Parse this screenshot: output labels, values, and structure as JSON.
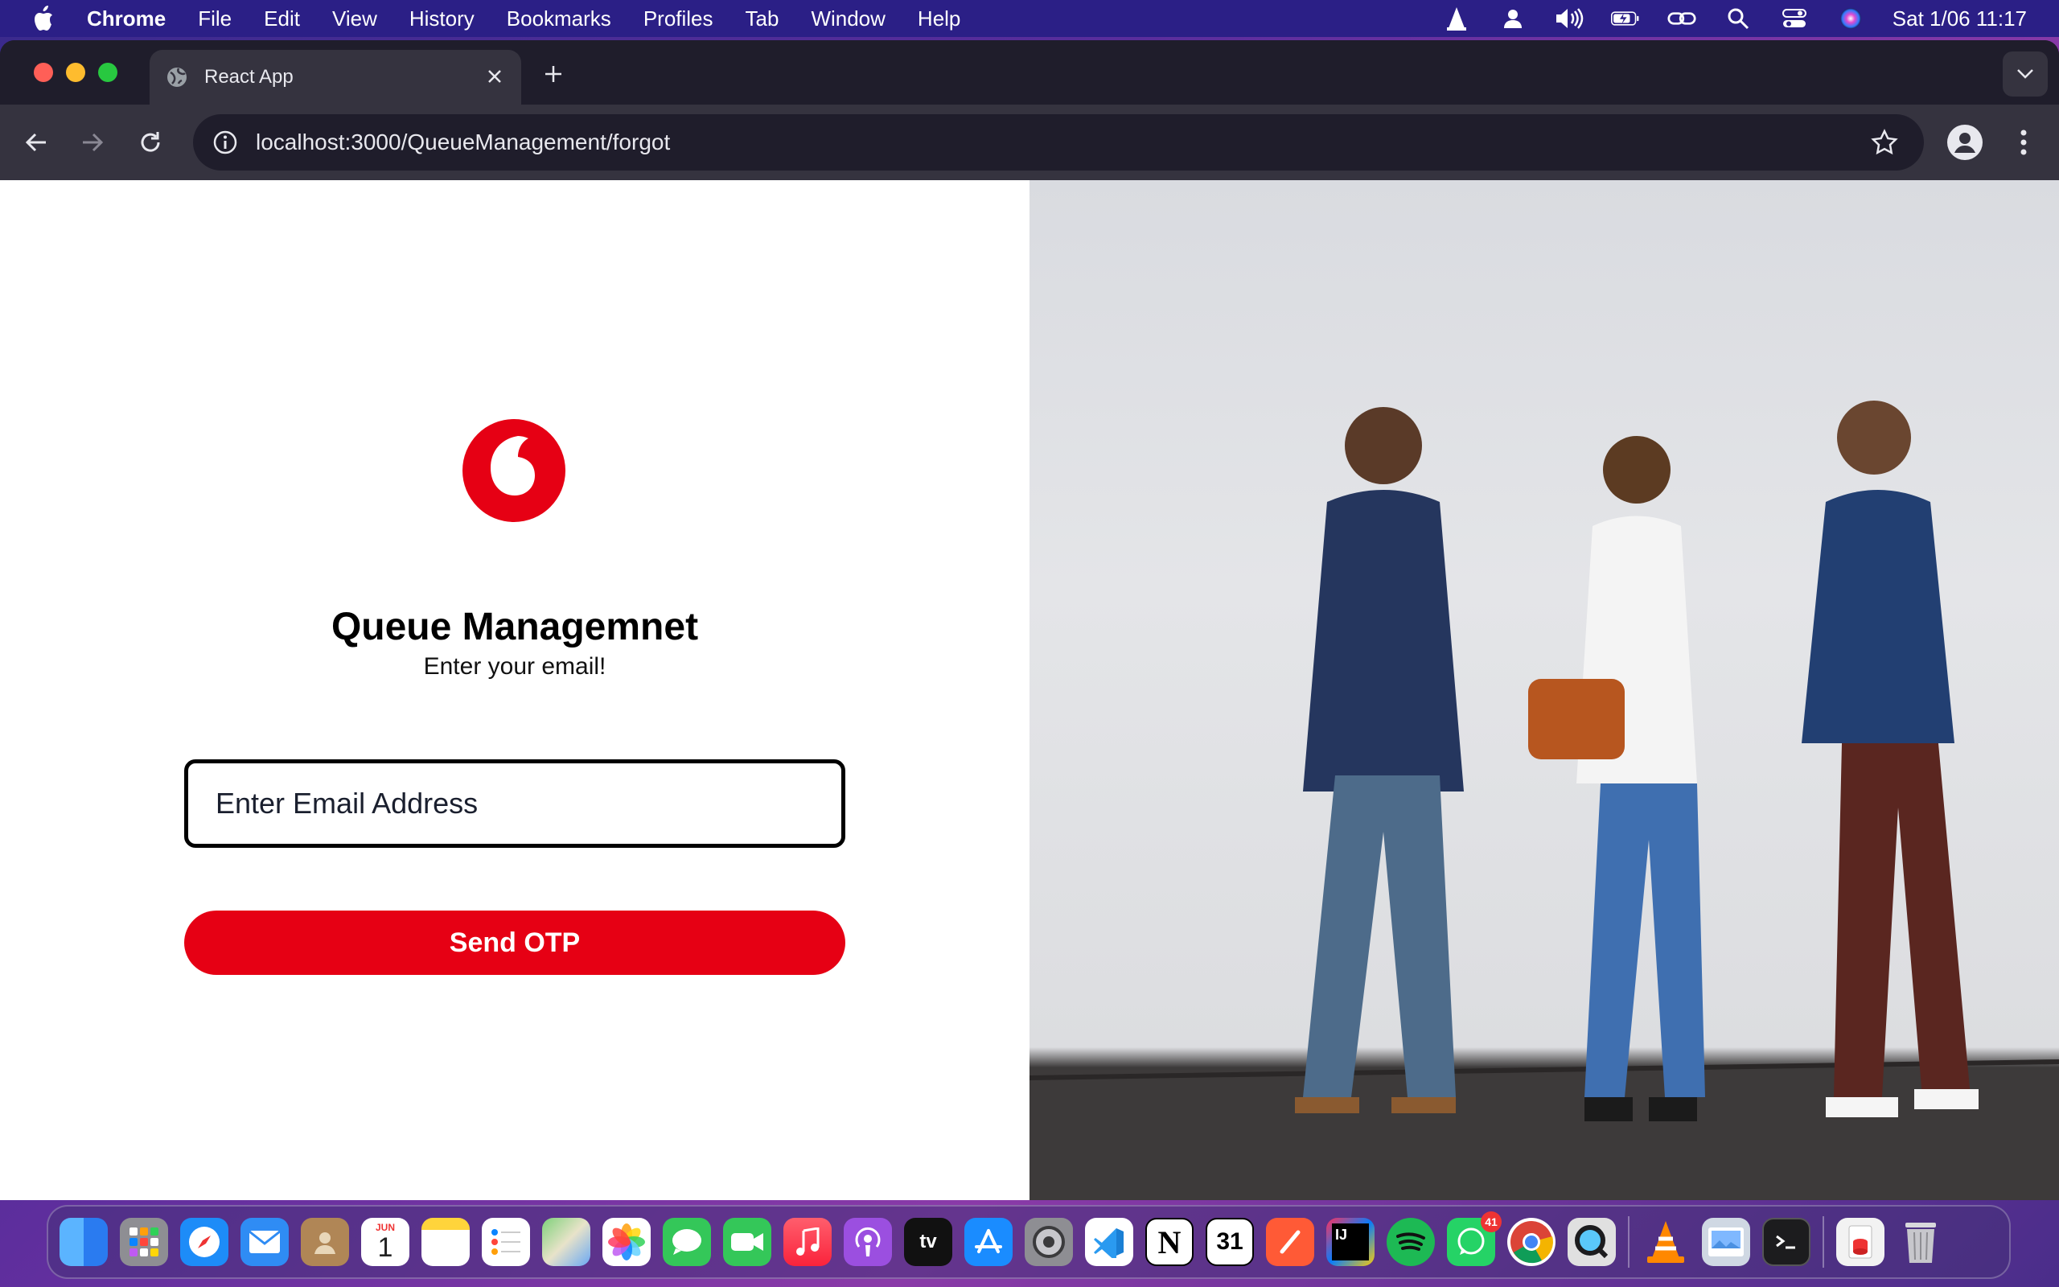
{
  "menubar": {
    "app_name": "Chrome",
    "items": [
      "File",
      "Edit",
      "View",
      "History",
      "Bookmarks",
      "Profiles",
      "Tab",
      "Window",
      "Help"
    ],
    "clock": "Sat 1/06  11:17"
  },
  "browser": {
    "tab_title": "React App",
    "url": "localhost:3000/QueueManagement/forgot"
  },
  "page": {
    "title": "Queue Managemnet",
    "subtitle": "Enter your email!",
    "email_placeholder": "Enter Email Address",
    "send_button": "Send OTP"
  },
  "dock": {
    "calendar_month": "JUN",
    "calendar_day": "1",
    "whatsapp_badge": "41",
    "notion_glyph": "N",
    "calendar31": "31",
    "intellij_glyph": "IJ",
    "appletv_label": "tv"
  },
  "colors": {
    "brand_red": "#e60014",
    "menubar": "#2b1f86",
    "browser_frame": "#35333f"
  }
}
